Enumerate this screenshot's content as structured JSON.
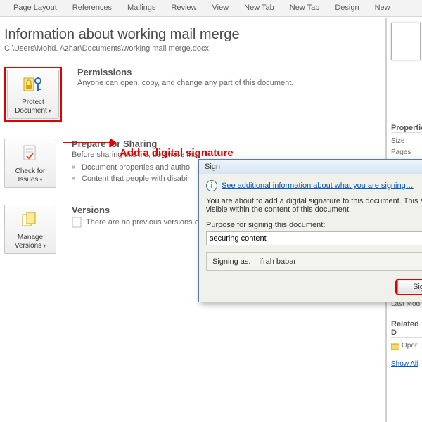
{
  "ribbon": {
    "tabs": [
      "Page Layout",
      "References",
      "Mailings",
      "Review",
      "View",
      "New Tab",
      "New Tab",
      "Design",
      "New"
    ]
  },
  "page": {
    "title": "Information about working mail merge",
    "path": "C:\\Users\\Mohd. Azhar\\Documents\\working mail merge.docx"
  },
  "annotation": "Add a digital signature",
  "permissions": {
    "button": "Protect Document",
    "heading": "Permissions",
    "text": "Anyone can open, copy, and change any part of this document."
  },
  "sharing": {
    "button": "Check for Issues",
    "heading": "Prepare for Sharing",
    "lead": "Before sharing this file, be aware that",
    "bullets": [
      "Document properties and autho",
      "Content that people with disabil"
    ]
  },
  "versions": {
    "button": "Manage Versions",
    "heading": "Versions",
    "text": "There are no previous versions o"
  },
  "right": {
    "prop_head": "Propertie",
    "size": "Size",
    "pages": "Pages",
    "lastmod": "Last Mod",
    "related_head": "Related D",
    "open": "Oper",
    "showall": "Show All"
  },
  "dialog": {
    "title": "Sign",
    "link": "See additional information about what you are signing…",
    "body": "You are about to add a digital signature to this document. This signat visible within the content of this document.",
    "purpose_label": "Purpose for signing this document:",
    "purpose_value": "securing content",
    "signing_as_label": "Signing as:",
    "signing_as_value": "ifrah babar",
    "sign_btn": "Sign"
  }
}
